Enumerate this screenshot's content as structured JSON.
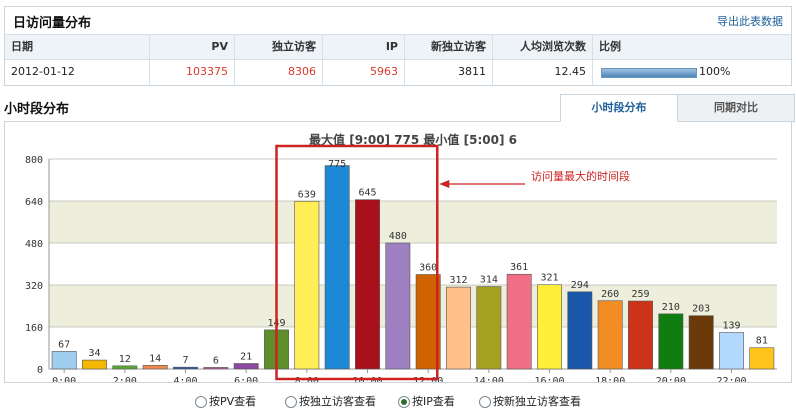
{
  "daily": {
    "title": "日访问量分布",
    "export": "导出此表数据",
    "headers": [
      "日期",
      "PV",
      "独立访客",
      "IP",
      "新独立访客",
      "人均浏览次数",
      "比例"
    ],
    "row": [
      "2012-01-12",
      "103375",
      "8306",
      "5963",
      "3811",
      "12.45"
    ],
    "ratio_text": "100%",
    "ratio_value": 1.0
  },
  "hourly": {
    "title": "小时段分布",
    "tabs": [
      "小时段分布",
      "同期对比"
    ]
  },
  "radios": [
    {
      "label": "按PV查看",
      "checked": false
    },
    {
      "label": "按独立访客查看",
      "checked": false
    },
    {
      "label": "按IP查看",
      "checked": true
    },
    {
      "label": "按新独立访客查看",
      "checked": false
    }
  ],
  "chart_data": {
    "type": "bar",
    "title": "最大值 [9:00]  775   最小值 [5:00]  6",
    "categories": [
      "0:00",
      "1:00",
      "2:00",
      "3:00",
      "4:00",
      "5:00",
      "6:00",
      "7:00",
      "8:00",
      "9:00",
      "10:00",
      "11:00",
      "12:00",
      "13:00",
      "14:00",
      "15:00",
      "16:00",
      "17:00",
      "18:00",
      "19:00",
      "20:00",
      "21:00",
      "22:00",
      "23:00"
    ],
    "values": [
      67,
      34,
      12,
      14,
      7,
      6,
      21,
      149,
      639,
      775,
      645,
      480,
      360,
      312,
      314,
      361,
      321,
      294,
      260,
      259,
      210,
      203,
      139,
      81
    ],
    "tick_labels_x": [
      "0:00",
      "2:00",
      "4:00",
      "6:00",
      "8:00",
      "10:00",
      "12:00",
      "14:00",
      "16:00",
      "18:00",
      "20:00",
      "22:00"
    ],
    "yticks": [
      0,
      160,
      320,
      480,
      640,
      800
    ],
    "ylim": [
      0,
      800
    ],
    "grid": true,
    "colors": [
      "#9fcdf0",
      "#f5b800",
      "#58a832",
      "#f18a4e",
      "#2f5da8",
      "#c55a9e",
      "#8a4aa0",
      "#5e8f2a",
      "#ffee55",
      "#1d89d6",
      "#a8101c",
      "#9e80c0",
      "#d16200",
      "#ffc08a",
      "#a6a020",
      "#f06f84",
      "#ffef3a",
      "#1b57a8",
      "#f28d24",
      "#cc3318",
      "#0f7d10",
      "#6a3a08",
      "#b3d9ff",
      "#ffc31a"
    ],
    "annotation": "访问量最大的时间段",
    "highlight_range": [
      8,
      12
    ],
    "highlight_color": "#cc2222"
  }
}
